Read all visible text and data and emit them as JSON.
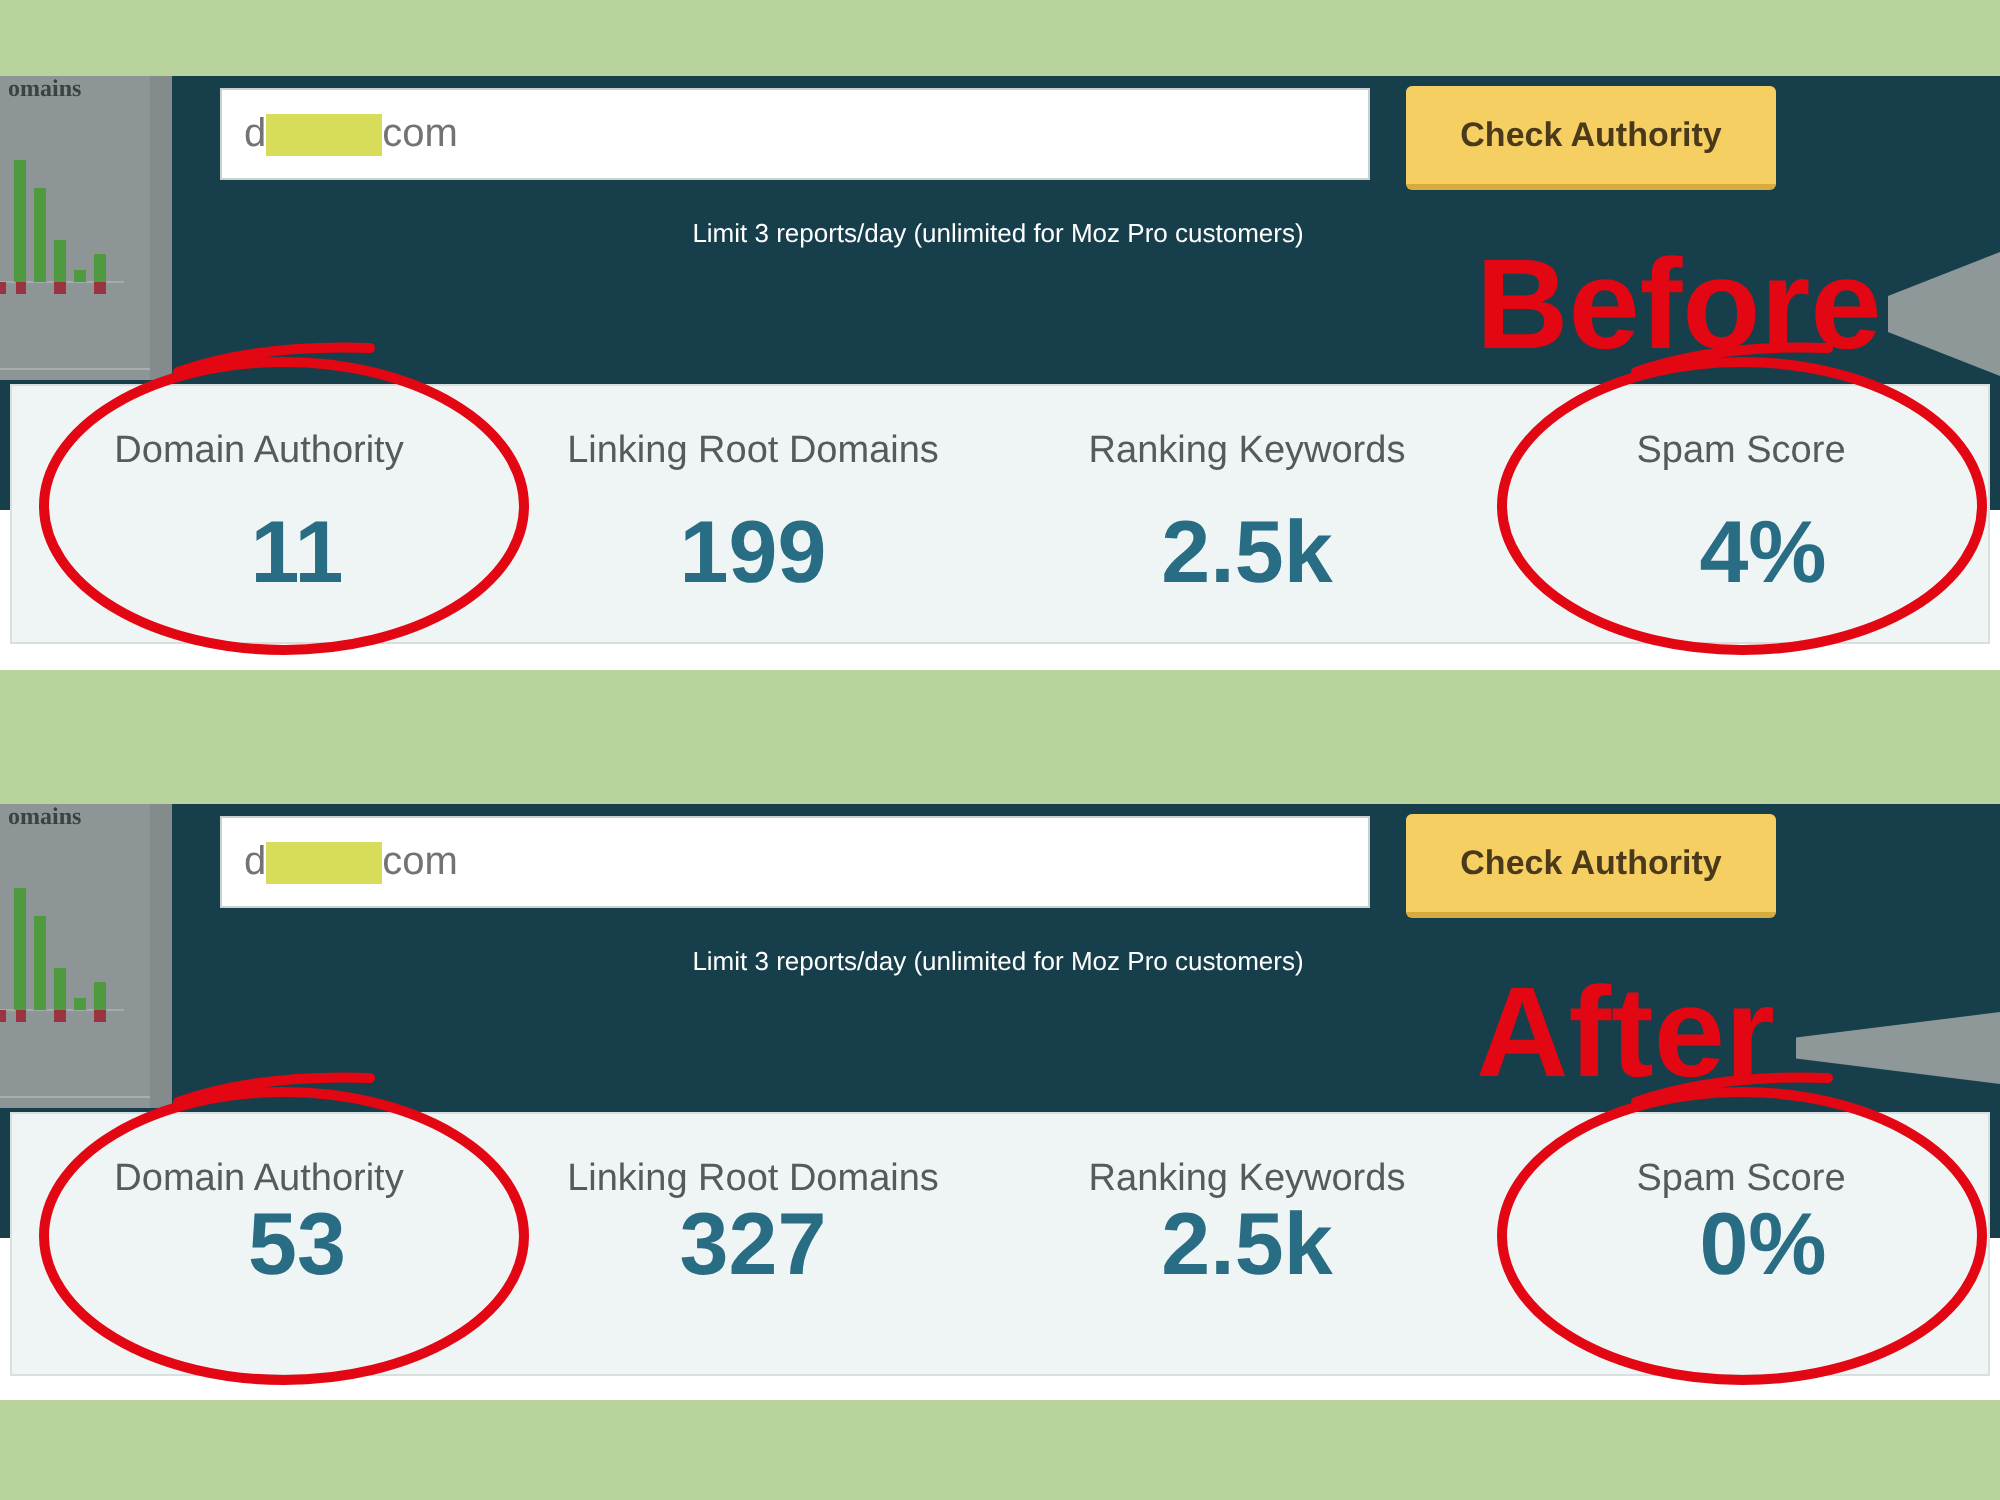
{
  "panels": [
    {
      "sidebar": {
        "heading": "omains"
      },
      "search": {
        "value_start": "d",
        "redacted": true,
        "value_end": "com"
      },
      "button": "Check Authority",
      "note": "Limit 3 reports/day (unlimited for Moz Pro customers)",
      "annotation": "Before",
      "metrics": [
        {
          "label": "Domain Authority",
          "value": "11",
          "circled": true
        },
        {
          "label": "Linking Root Domains",
          "value": "199",
          "circled": false
        },
        {
          "label": "Ranking Keywords",
          "value": "2.5k",
          "circled": false
        },
        {
          "label": "Spam Score",
          "value": "4%",
          "circled": true
        }
      ]
    },
    {
      "sidebar": {
        "heading": "omains"
      },
      "search": {
        "value_start": "d",
        "redacted": true,
        "value_end": "com"
      },
      "button": "Check Authority",
      "note": "Limit 3 reports/day (unlimited for Moz Pro customers)",
      "annotation": "After",
      "metrics": [
        {
          "label": "Domain Authority",
          "value": "53",
          "circled": true
        },
        {
          "label": "Linking Root Domains",
          "value": "327",
          "circled": false
        },
        {
          "label": "Ranking Keywords",
          "value": "2.5k",
          "circled": false
        },
        {
          "label": "Spam Score",
          "value": "0%",
          "circled": true
        }
      ]
    }
  ]
}
